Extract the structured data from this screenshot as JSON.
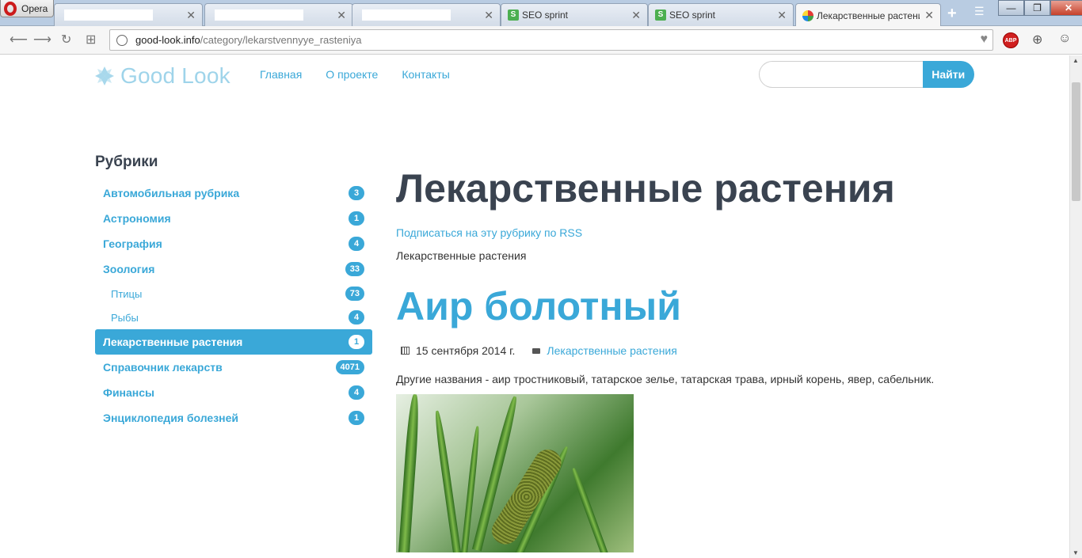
{
  "browser": {
    "opera_label": "Opera",
    "tabs": [
      {
        "label": "",
        "redacted": true
      },
      {
        "label": "",
        "redacted": true
      },
      {
        "label": "",
        "redacted": true
      },
      {
        "label": "SEO sprint"
      },
      {
        "label": "SEO sprint"
      },
      {
        "label": "Лекарственные растени"
      }
    ],
    "url_domain": "good-look.info",
    "url_path": "/category/lekarstvennyye_rasteniya",
    "abp_label": "ABP",
    "window_controls": {
      "minimize": "—",
      "maximize": "❐",
      "close": "✕"
    }
  },
  "site": {
    "logo_text": "Good Look",
    "nav": [
      "Главная",
      "О проекте",
      "Контакты"
    ],
    "search_placeholder": "",
    "search_button": "Найти"
  },
  "sidebar": {
    "title": "Рубрики",
    "items": [
      {
        "label": "Автомобильная рубрика",
        "count": "3"
      },
      {
        "label": "Астрономия",
        "count": "1"
      },
      {
        "label": "География",
        "count": "4"
      },
      {
        "label": "Зоология",
        "count": "33"
      },
      {
        "label": "Птицы",
        "count": "73"
      },
      {
        "label": "Рыбы",
        "count": "4"
      },
      {
        "label": "Лекарственные растения",
        "count": "1"
      },
      {
        "label": "Справочник лекарств",
        "count": "4071"
      },
      {
        "label": "Финансы",
        "count": "4"
      },
      {
        "label": "Энциклопедия болезней",
        "count": "1"
      }
    ]
  },
  "content": {
    "category_title": "Лекарственные растения",
    "rss_link": "Подписаться на эту рубрику по RSS",
    "category_description": "Лекарственные растения",
    "post": {
      "title": "Аир болотный",
      "date": "15 сентября 2014 г.",
      "category": "Лекарственные растения",
      "excerpt": "Другие названия - аир тростниковый, татарское зелье, татарская трава, ирный корень, явер, сабельник."
    }
  },
  "colors": {
    "accent": "#3aa8d8",
    "heading": "#3a4350",
    "logo": "#9fd4ea"
  }
}
